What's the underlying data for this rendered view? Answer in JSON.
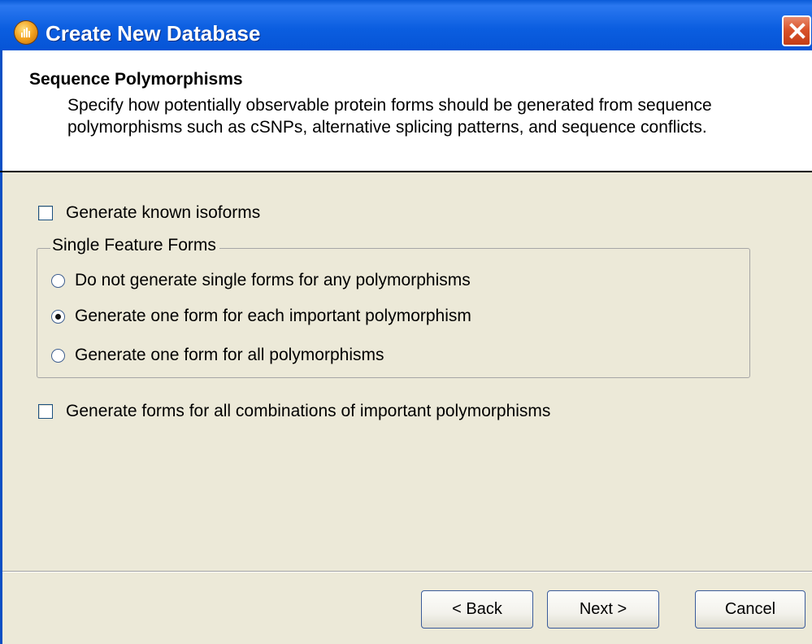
{
  "window": {
    "title": "Create New Database",
    "close_icon": "close-icon",
    "app_icon": "app-logo-icon"
  },
  "header": {
    "title": "Sequence Polymorphisms",
    "description": "Specify how potentially observable protein forms should be generated from sequence polymorphisms such as cSNPs, alternative splicing patterns, and sequence conflicts."
  },
  "options": {
    "known_isoforms": {
      "label": "Generate known isoforms",
      "checked": false
    },
    "single_feature_forms": {
      "legend": "Single Feature Forms",
      "radios": [
        {
          "label": "Do not generate single forms for any polymorphisms",
          "checked": false
        },
        {
          "label": "Generate one form for each important polymorphism",
          "checked": true
        },
        {
          "label": "Generate one form for all polymorphisms",
          "checked": false
        }
      ]
    },
    "combinations": {
      "label": "Generate forms for all combinations of important polymorphisms",
      "checked": false
    }
  },
  "buttons": {
    "back": "< Back",
    "next": "Next >",
    "cancel": "Cancel"
  }
}
